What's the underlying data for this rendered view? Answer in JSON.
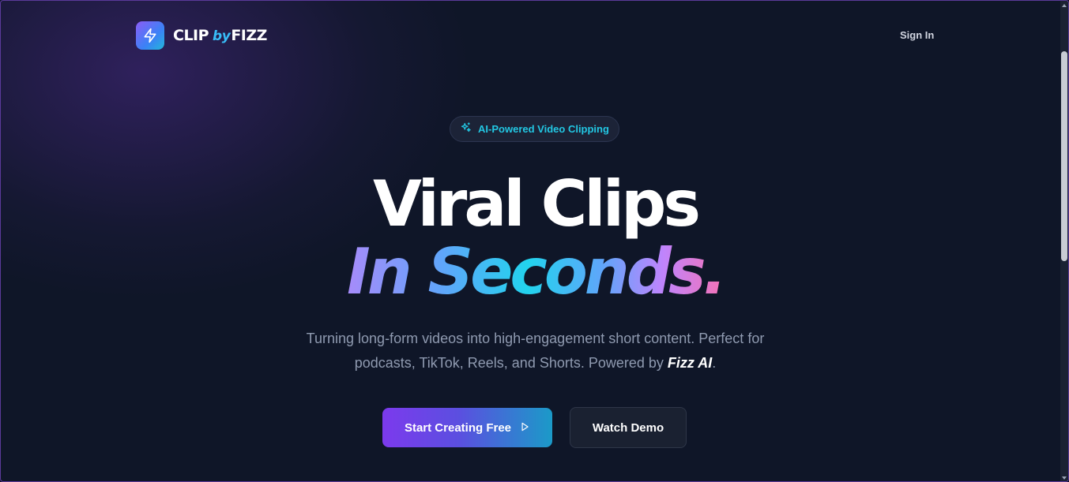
{
  "brand": {
    "logo_icon": "lightning-bolt-icon",
    "name_part1": "CLIP",
    "name_by": "by",
    "name_part2": "FIZZ"
  },
  "nav": {
    "signin_label": "Sign In"
  },
  "hero": {
    "badge_icon": "sparkles-icon",
    "badge_text": "AI-Powered Video Clipping",
    "headline_line1": "Viral Clips",
    "headline_line2": "In Seconds.",
    "subtitle_line1": "Turning long-form videos into high-engagement short content. Perfect for",
    "subtitle_line2_prefix": "podcasts, TikTok, Reels, and Shorts. Powered by ",
    "subtitle_brand": "Fizz AI",
    "subtitle_end": "."
  },
  "cta": {
    "primary_label": "Start Creating Free",
    "primary_icon": "play-icon",
    "secondary_label": "Watch Demo"
  },
  "colors": {
    "background": "#0f1628",
    "accent_purple": "#7c3aed",
    "accent_cyan": "#22c7e3",
    "gradient_pink": "#f472b6"
  }
}
